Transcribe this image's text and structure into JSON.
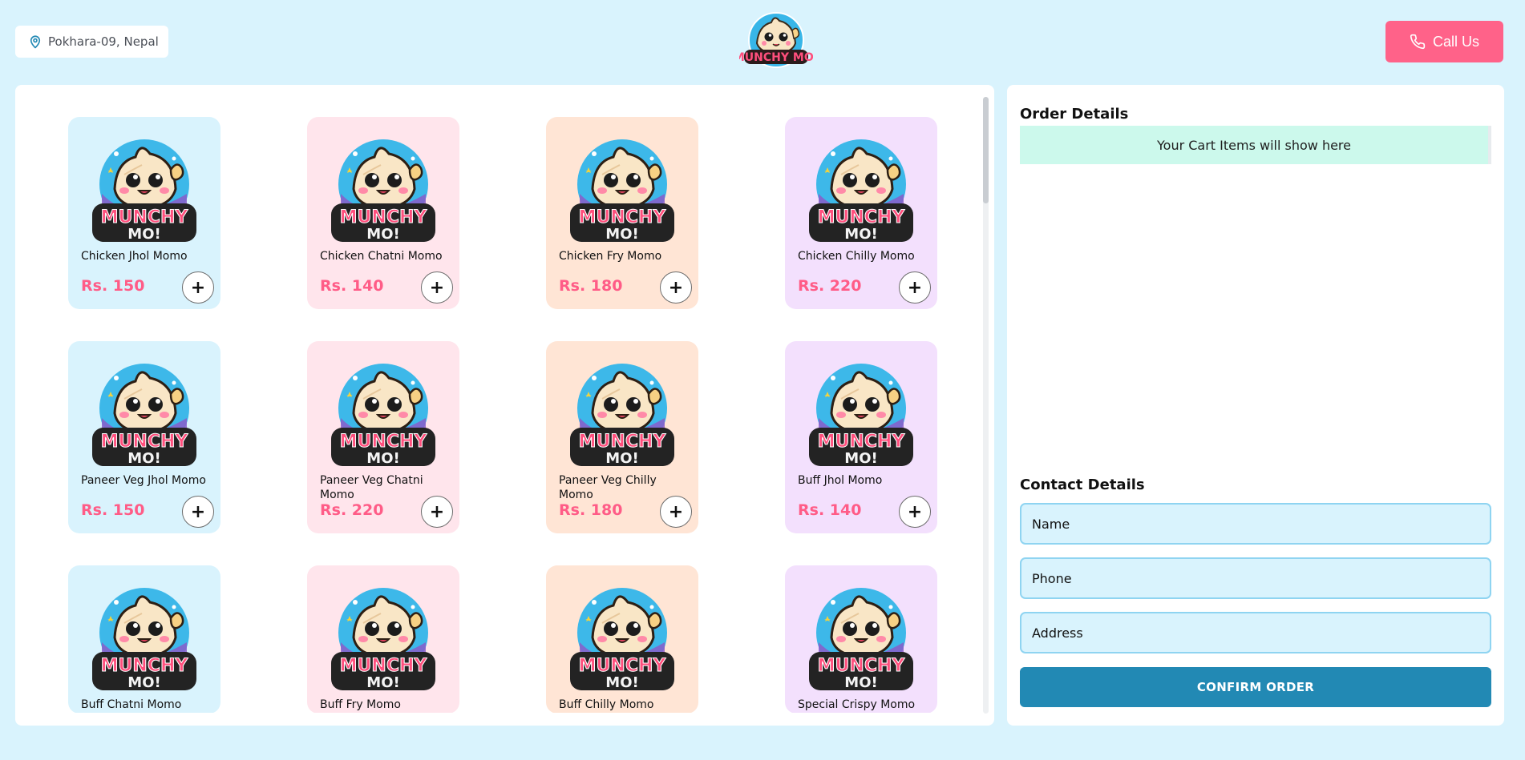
{
  "header": {
    "location": "Pokhara-09, Nepal",
    "logo_text": "MUNCHY MO!",
    "call_label": "Call Us"
  },
  "colors": {
    "accent_pink": "#ff6289",
    "price_pink": "#ff5c87",
    "confirm_blue": "#2289b4",
    "page_bg": "#d9f3fd",
    "card_blue": "#d9f3fd",
    "card_pink": "#ffe5ec",
    "card_peach": "#ffe5d5",
    "card_lavender": "#f3e0fd",
    "cart_mint": "#ccf9ec"
  },
  "menu": {
    "add_label": "+",
    "items": [
      {
        "name": "Chicken Jhol Momo",
        "price": "Rs. 150",
        "color": "blue"
      },
      {
        "name": "Chicken Chatni Momo",
        "price": "Rs. 140",
        "color": "pink"
      },
      {
        "name": "Chicken Fry Momo",
        "price": "Rs. 180",
        "color": "peach"
      },
      {
        "name": "Chicken Chilly Momo",
        "price": "Rs. 220",
        "color": "lavender"
      },
      {
        "name": "Paneer Veg Jhol Momo",
        "price": "Rs. 150",
        "color": "blue"
      },
      {
        "name": "Paneer Veg Chatni Momo",
        "price": "Rs. 220",
        "color": "pink"
      },
      {
        "name": "Paneer Veg Chilly Momo",
        "price": "Rs. 180",
        "color": "peach"
      },
      {
        "name": "Buff Jhol Momo",
        "price": "Rs. 140",
        "color": "lavender"
      },
      {
        "name": "Buff Chatni Momo",
        "price": "",
        "color": "blue"
      },
      {
        "name": "Buff Fry Momo",
        "price": "",
        "color": "pink"
      },
      {
        "name": "Buff Chilly Momo",
        "price": "",
        "color": "peach"
      },
      {
        "name": "Special Crispy Momo",
        "price": "",
        "color": "lavender"
      }
    ]
  },
  "order": {
    "title": "Order Details",
    "empty_text": "Your Cart Items will show here"
  },
  "contact": {
    "title": "Contact Details",
    "name_placeholder": "Name",
    "phone_placeholder": "Phone",
    "address_placeholder": "Address",
    "confirm_label": "CONFIRM ORDER"
  },
  "icons": {
    "location": "map-pin-icon",
    "call": "phone-icon",
    "add": "plus-icon"
  }
}
